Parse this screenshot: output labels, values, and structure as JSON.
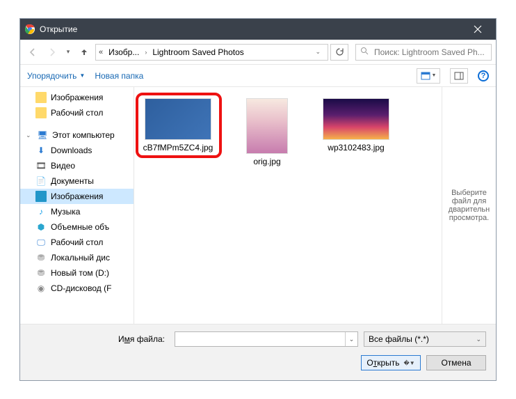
{
  "titlebar": {
    "title": "Открытие"
  },
  "nav": {
    "crumb1": "Изобр...",
    "crumb2": "Lightroom Saved Photos",
    "search_placeholder": "Поиск: Lightroom Saved Ph..."
  },
  "toolbar": {
    "organise": "Упорядочить",
    "newfolder": "Новая папка"
  },
  "tree": {
    "images": "Изображения",
    "desktop": "Рабочий стол",
    "thispc": "Этот компьютер",
    "downloads": "Downloads",
    "video": "Видео",
    "documents": "Документы",
    "images2": "Изображения",
    "music": "Музыка",
    "objects": "Объемные объ",
    "desktop2": "Рабочий стол",
    "localdisk": "Локальный дис",
    "newvol": "Новый том (D:)",
    "cd": "CD-дисковод (F"
  },
  "files": {
    "f1": "cB7fMPm5ZC4.jpg",
    "f2": "orig.jpg",
    "f3": "wp3102483.jpg"
  },
  "preview": {
    "text": "Выберите файл для дварительн просмотра."
  },
  "footer": {
    "filename_label_pre": "И",
    "filename_label_u": "м",
    "filename_label_post": "я файла:",
    "filter": "Все файлы (*.*)",
    "open_pre": "О",
    "open_u": "т",
    "open_post": "крыть",
    "cancel": "Отмена"
  }
}
